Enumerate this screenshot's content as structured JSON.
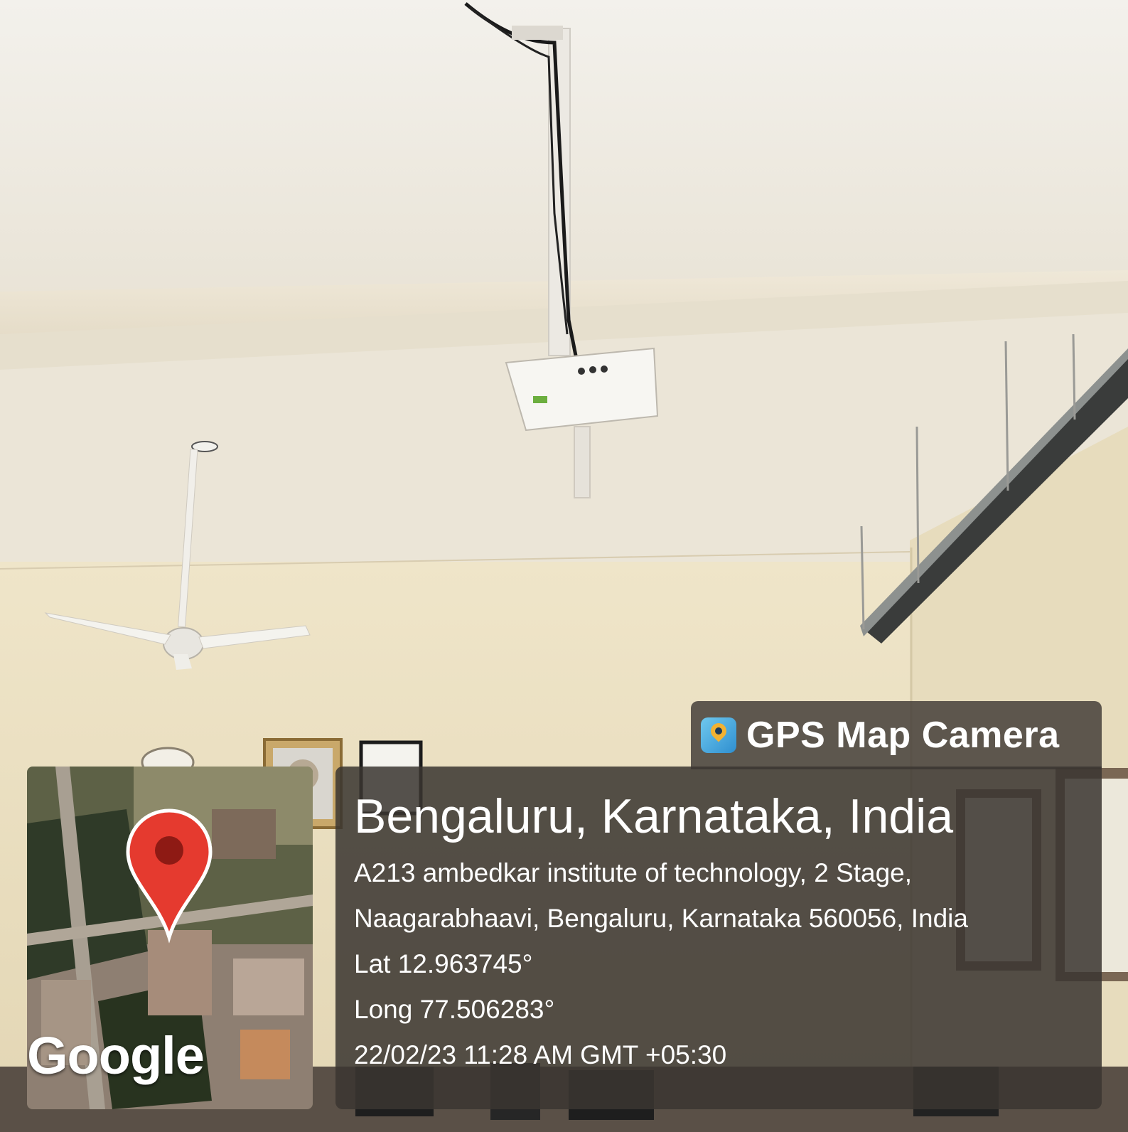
{
  "overlay": {
    "app_name": "GPS Map Camera",
    "app_icon": "gps-map-camera-icon",
    "place_title": "Bengaluru, Karnataka, India",
    "address_line1": "A213 ambedkar institute of technology, 2 Stage,",
    "address_line2": "Naagarabhaavi, Bengaluru, Karnataka 560056, India",
    "latitude": "Lat 12.963745°",
    "longitude": "Long 77.506283°",
    "datetime": "22/02/23 11:28 AM GMT +05:30"
  },
  "map": {
    "logo_text": "Google",
    "marker_icon": "map-pin-icon",
    "marker_color": "#e53a2f"
  },
  "colors": {
    "panel": "#3a3631",
    "ceiling": "#ece7dc",
    "wall": "#eadfc2"
  }
}
